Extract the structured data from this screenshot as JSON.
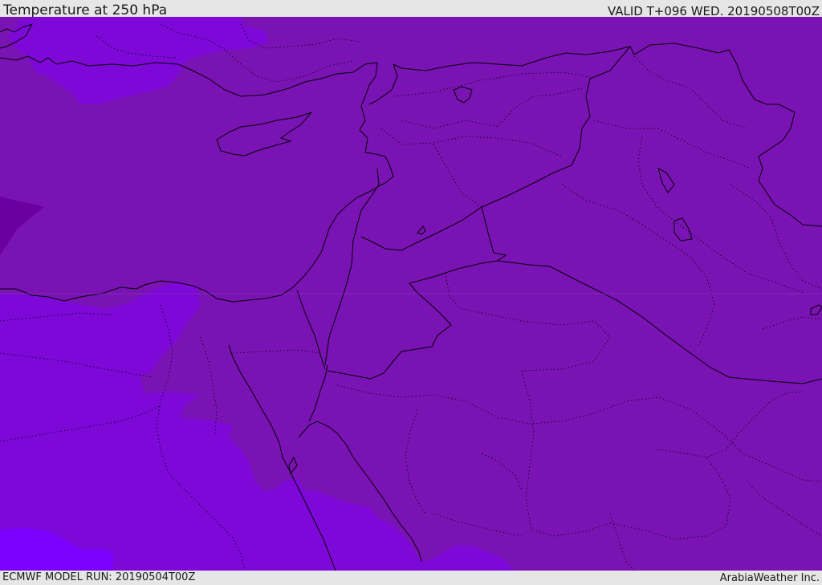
{
  "header": {
    "title": "Temperature at 250 hPa",
    "valid": "VALID T+096 WED. 20190508T00Z"
  },
  "footer": {
    "model_run": "ECMWF MODEL RUN: 20190504T00Z",
    "credit": "ArabiaWeather Inc."
  },
  "map": {
    "region": "Eastern Mediterranean and Middle East",
    "colors": {
      "base_field": "#7a13b3",
      "cooler_field": "#7d08d8",
      "coldest_field": "#7a00ff",
      "warm_pocket": "#6b009e",
      "borders": "#000000"
    }
  }
}
